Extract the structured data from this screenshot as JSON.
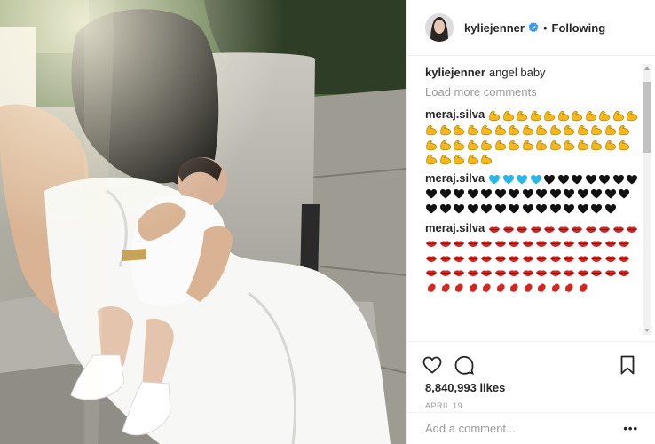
{
  "post": {
    "username": "kyliejenner",
    "follow_status": "Following",
    "separator": "•",
    "verified_icon": "verified-badge-icon"
  },
  "caption": {
    "username": "kyliejenner",
    "text": "angel baby"
  },
  "load_more_label": "Load more comments",
  "comments": [
    {
      "username": "meraj.silva",
      "emoji": "flexed-biceps",
      "count": 46
    },
    {
      "username": "meraj.silva",
      "emoji": "hearts-blue-then-black",
      "blue": 4,
      "black": 36
    },
    {
      "username": "meraj.silva",
      "emoji": "lips-and-kiss",
      "count": 68
    }
  ],
  "likes_text": "8,840,993 likes",
  "date_text": "APRIL 19",
  "add_comment_placeholder": "Add a comment...",
  "options_label": "•••",
  "colors": {
    "link": "#262626",
    "muted": "#999999",
    "border": "#efefef",
    "bicep": "#f5b719",
    "heart_blue": "#29b6e8",
    "lips": "#d3261c"
  }
}
